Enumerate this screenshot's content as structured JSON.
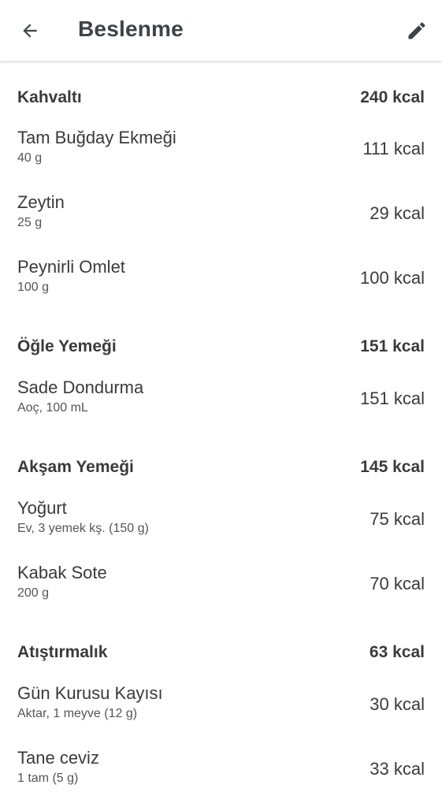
{
  "appbar": {
    "title": "Beslenme",
    "back_icon": "arrow-left-icon",
    "edit_icon": "pencil-icon"
  },
  "sections": [
    {
      "title": "Kahvaltı",
      "total": "240 kcal",
      "items": [
        {
          "name": "Tam Buğday Ekmeği",
          "portion": "40 g",
          "kcal": "111 kcal"
        },
        {
          "name": "Zeytin",
          "portion": "25 g",
          "kcal": "29 kcal"
        },
        {
          "name": "Peynirli Omlet",
          "portion": "100 g",
          "kcal": "100 kcal"
        }
      ]
    },
    {
      "title": "Öğle Yemeği",
      "total": "151 kcal",
      "items": [
        {
          "name": "Sade Dondurma",
          "portion": "Aoç, 100 mL",
          "kcal": "151 kcal"
        }
      ]
    },
    {
      "title": "Akşam Yemeği",
      "total": "145 kcal",
      "items": [
        {
          "name": "Yoğurt",
          "portion": "Ev, 3 yemek kş. (150 g)",
          "kcal": "75 kcal"
        },
        {
          "name": "Kabak Sote",
          "portion": "200 g",
          "kcal": "70 kcal"
        }
      ]
    },
    {
      "title": "Atıştırmalık",
      "total": "63 kcal",
      "items": [
        {
          "name": "Gün Kurusu Kayısı",
          "portion": "Aktar, 1 meyve (12 g)",
          "kcal": "30 kcal"
        },
        {
          "name": "Tane ceviz",
          "portion": "1 tam (5 g)",
          "kcal": "33 kcal"
        }
      ]
    }
  ]
}
